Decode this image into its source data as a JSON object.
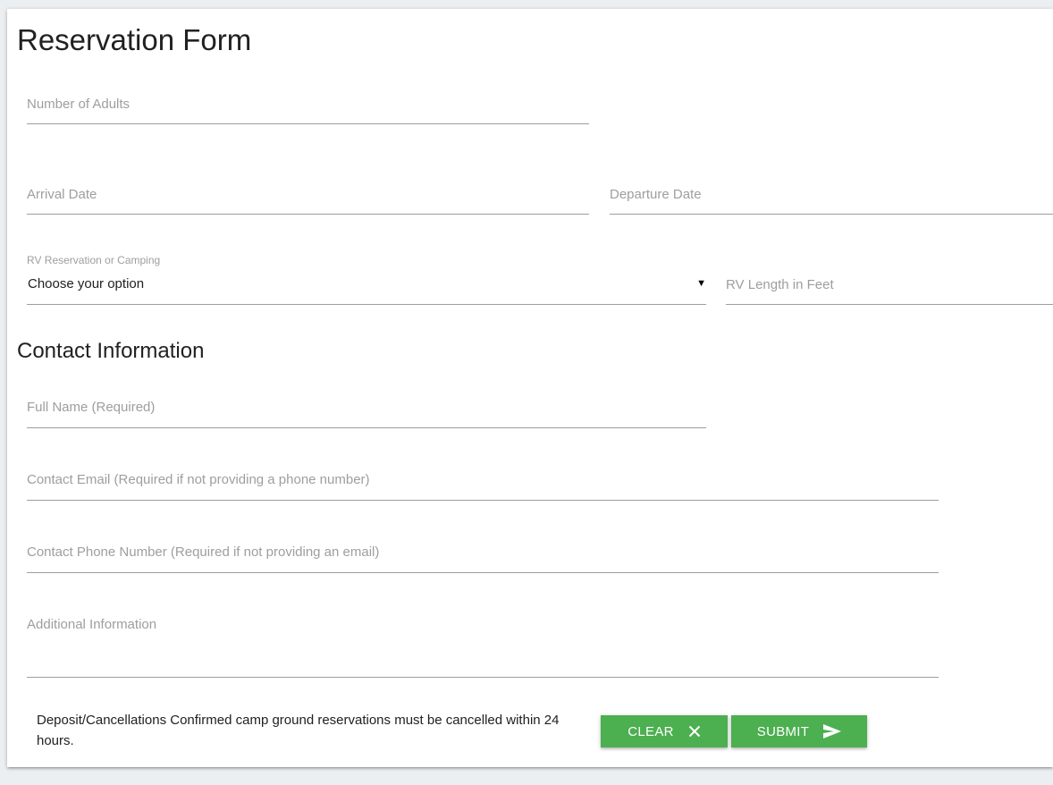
{
  "form": {
    "title": "Reservation Form",
    "adults_placeholder": "Number of Adults",
    "arrival_placeholder": "Arrival Date",
    "departure_placeholder": "Departure Date",
    "rv_type_label": "RV Reservation or Camping",
    "rv_type_selected": "Choose your option",
    "rv_length_placeholder": "RV Length in Feet"
  },
  "contact": {
    "title": "Contact Information",
    "full_name_placeholder": "Full Name (Required)",
    "email_placeholder": "Contact Email (Required if not providing a phone number)",
    "phone_placeholder": "Contact Phone Number (Required if not providing an email)",
    "additional_placeholder": "Additional Information"
  },
  "footer": {
    "notice": "Deposit/Cancellations Confirmed camp ground reservations must be cancelled within 24 hours.",
    "clear_label": "CLEAR",
    "submit_label": "SUBMIT"
  },
  "icons": {
    "clear": "close-icon",
    "submit": "send-icon"
  },
  "colors": {
    "accent": "#4caf50",
    "background": "#eceff1",
    "card": "#ffffff",
    "underline": "#9e9e9e",
    "placeholder": "#9e9e9e"
  }
}
